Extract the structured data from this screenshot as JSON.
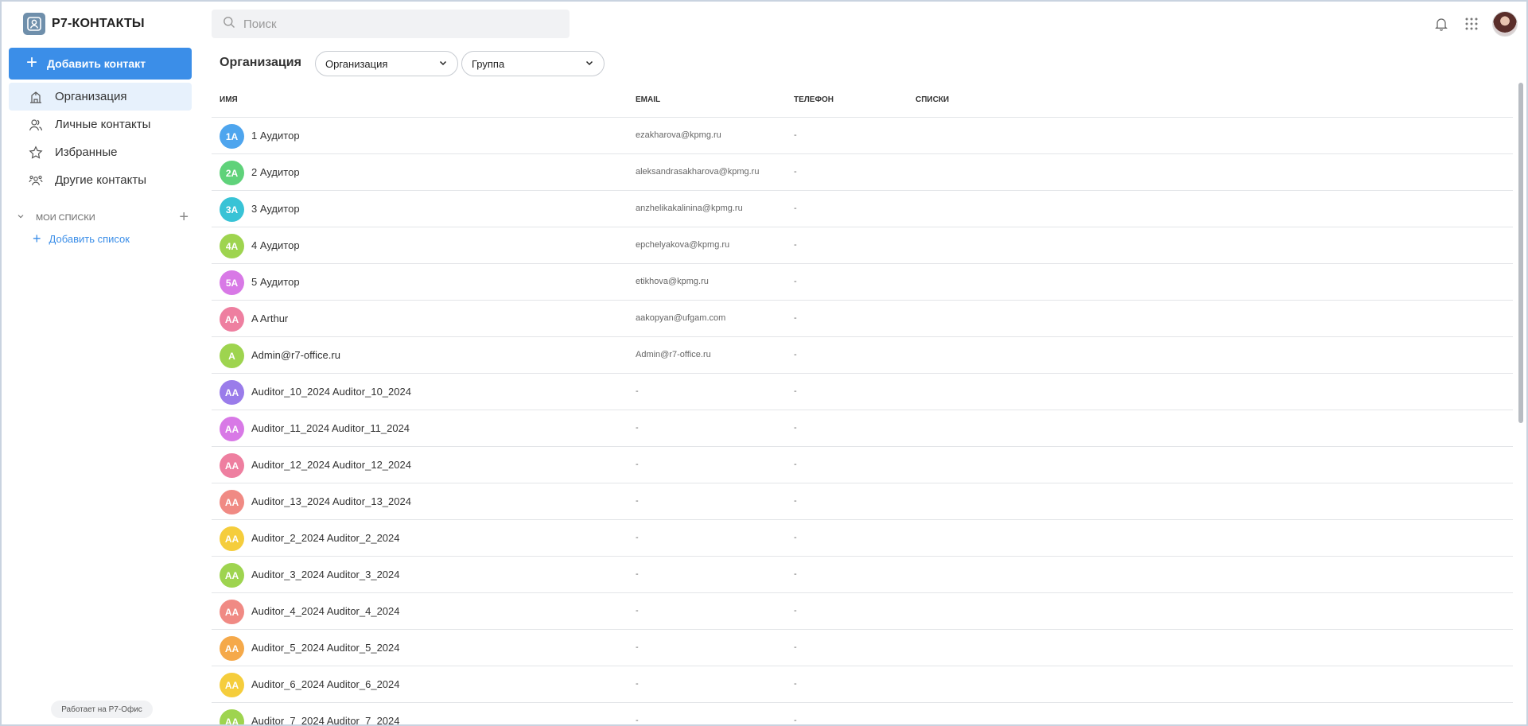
{
  "app": {
    "title": "Р7-КОНТАКТЫ"
  },
  "sidebar": {
    "add_contact_label": "Добавить контакт",
    "items": [
      {
        "label": "Организация",
        "icon": "building-icon",
        "active": true
      },
      {
        "label": "Личные контакты",
        "icon": "people-icon",
        "active": false
      },
      {
        "label": "Избранные",
        "icon": "star-icon",
        "active": false
      },
      {
        "label": "Другие контакты",
        "icon": "group-icon",
        "active": false
      }
    ],
    "my_lists_title": "МОИ СПИСКИ",
    "add_list_label": "Добавить список",
    "powered_by": "Работает на Р7-Офис"
  },
  "search": {
    "placeholder": "Поиск",
    "value": ""
  },
  "main": {
    "title": "Организация",
    "filter_organization": "Организация",
    "filter_group": "Группа",
    "columns": {
      "name": "ИМЯ",
      "email": "EMAIL",
      "phone": "ТЕЛЕФОН",
      "lists": "СПИСКИ"
    },
    "rows": [
      {
        "initials": "1А",
        "color": "#4ea5ee",
        "name": "1 Аудитор",
        "email": "ezakharova@kpmg.ru",
        "phone": "-"
      },
      {
        "initials": "2А",
        "color": "#5fd27a",
        "name": "2 Аудитор",
        "email": "aleksandrasakharova@kpmg.ru",
        "phone": "-"
      },
      {
        "initials": "3А",
        "color": "#38c3d6",
        "name": "3 Аудитор",
        "email": "anzhelikakalinina@kpmg.ru",
        "phone": "-"
      },
      {
        "initials": "4А",
        "color": "#9ed44f",
        "name": "4 Аудитор",
        "email": "epchelyakova@kpmg.ru",
        "phone": "-"
      },
      {
        "initials": "5А",
        "color": "#d879e6",
        "name": "5 Аудитор",
        "email": "etikhova@kpmg.ru",
        "phone": "-"
      },
      {
        "initials": "AA",
        "color": "#ee7fa0",
        "name": "A Arthur",
        "email": "aakopyan@ufgam.com",
        "phone": "-"
      },
      {
        "initials": "A",
        "color": "#9ed44f",
        "name": "Admin@r7-office.ru",
        "email": "Admin@r7-office.ru",
        "phone": "-"
      },
      {
        "initials": "AA",
        "color": "#9a7cea",
        "name": "Auditor_10_2024 Auditor_10_2024",
        "email": "-",
        "phone": "-"
      },
      {
        "initials": "AA",
        "color": "#d879e6",
        "name": "Auditor_11_2024 Auditor_11_2024",
        "email": "-",
        "phone": "-"
      },
      {
        "initials": "AA",
        "color": "#ee7fa0",
        "name": "Auditor_12_2024 Auditor_12_2024",
        "email": "-",
        "phone": "-"
      },
      {
        "initials": "AA",
        "color": "#f08a84",
        "name": "Auditor_13_2024 Auditor_13_2024",
        "email": "-",
        "phone": "-"
      },
      {
        "initials": "AA",
        "color": "#f5cd3c",
        "name": "Auditor_2_2024 Auditor_2_2024",
        "email": "-",
        "phone": "-"
      },
      {
        "initials": "AA",
        "color": "#9ed44f",
        "name": "Auditor_3_2024 Auditor_3_2024",
        "email": "-",
        "phone": "-"
      },
      {
        "initials": "AA",
        "color": "#f08a84",
        "name": "Auditor_4_2024 Auditor_4_2024",
        "email": "-",
        "phone": "-"
      },
      {
        "initials": "AA",
        "color": "#f5a94a",
        "name": "Auditor_5_2024 Auditor_5_2024",
        "email": "-",
        "phone": "-"
      },
      {
        "initials": "AA",
        "color": "#f5cd3c",
        "name": "Auditor_6_2024 Auditor_6_2024",
        "email": "-",
        "phone": "-"
      },
      {
        "initials": "AA",
        "color": "#9ed44f",
        "name": "Auditor_7_2024 Auditor_7_2024",
        "email": "-",
        "phone": "-"
      }
    ]
  },
  "colors": {
    "accent": "#3b8ee8",
    "active_bg": "#e7f1fc",
    "border": "#e3e5e8"
  }
}
